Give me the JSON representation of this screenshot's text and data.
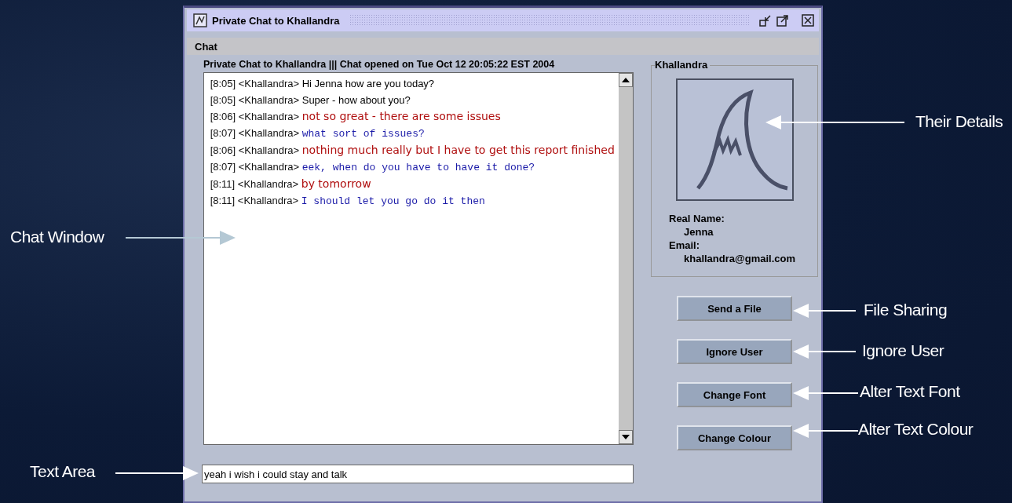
{
  "window": {
    "title": "Private Chat to Khallandra"
  },
  "menu": [
    "Chat"
  ],
  "chat": {
    "header": "Private Chat to Khallandra ||| Chat opened on Tue Oct 12 20:05:22 EST 2004",
    "messages": [
      {
        "time": "[8:05]",
        "user": "<Khallandra>",
        "text": "Hi Jenna how are you today?",
        "kind": "plain",
        "color": "#000000"
      },
      {
        "time": "[8:05]",
        "user": "<Khallandra>",
        "text": "Super - how about you?",
        "kind": "plain",
        "color": "#000000"
      },
      {
        "time": "[8:06]",
        "user": "<Khallandra>",
        "text": "not so great - there are some issues",
        "kind": "comic",
        "color": "#b01010"
      },
      {
        "time": "[8:07]",
        "user": "<Khallandra>",
        "text": "what sort of issues?",
        "kind": "mono",
        "color": "#1a1aa8"
      },
      {
        "time": "[8:06]",
        "user": "<Khallandra>",
        "text": "nothing much really but I have to get this report finished",
        "kind": "comic",
        "color": "#b01010"
      },
      {
        "time": "[8:07]",
        "user": "<Khallandra>",
        "text": "eek, when do you have to have it done?",
        "kind": "mono",
        "color": "#1a1aa8"
      },
      {
        "time": "[8:11]",
        "user": "<Khallandra>",
        "text": "by tomorrow",
        "kind": "comic",
        "color": "#b01010"
      },
      {
        "time": "[8:11]",
        "user": "<Khallandra>",
        "text": "I should let you go do it then",
        "kind": "mono",
        "color": "#1a1aa8"
      }
    ]
  },
  "input": {
    "value": "yeah i wish i could stay and talk"
  },
  "profile": {
    "name": "Khallandra",
    "fields": [
      {
        "label": "Real Name:",
        "value": "Jenna"
      },
      {
        "label": "Email:",
        "value": "khallandra@gmail.com"
      }
    ]
  },
  "buttons": [
    "Send a File",
    "Ignore User",
    "Change Font",
    "Change Colour"
  ],
  "callouts": [
    {
      "text": "Their Details"
    },
    {
      "text": "Chat Window"
    },
    {
      "text": "File Sharing"
    },
    {
      "text": "Ignore User"
    },
    {
      "text": "Alter Text Font"
    },
    {
      "text": "Alter Text Colour"
    },
    {
      "text": "Text Area"
    }
  ]
}
